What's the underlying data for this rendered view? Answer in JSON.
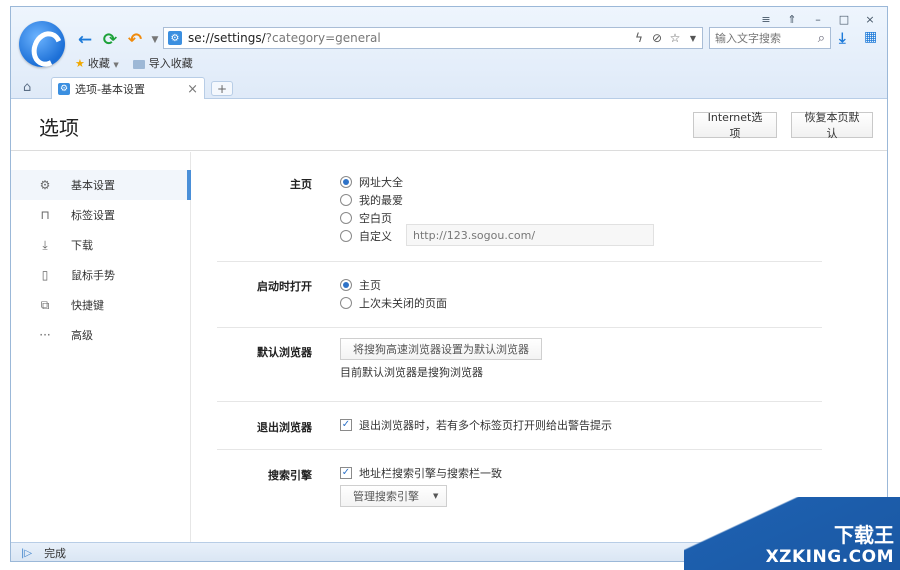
{
  "window": {
    "controls": [
      "≡",
      "⇑",
      "–",
      "□",
      "×"
    ]
  },
  "nav": {
    "back_icon": "arrow-left-icon",
    "refresh_icon": "refresh-icon",
    "undo_icon": "undo-icon"
  },
  "address": {
    "url_prefix": "se://settings/",
    "url_query": "?category=general"
  },
  "search": {
    "placeholder": "输入文字搜索"
  },
  "favbar": {
    "favorites": "收藏",
    "import": "导入收藏"
  },
  "tab": {
    "title": "选项-基本设置"
  },
  "header": {
    "title": "选项",
    "internet_options": "Internet选项",
    "reset_defaults": "恢复本页默认"
  },
  "sidebar": {
    "items": [
      {
        "label": "基本设置",
        "icon": "gear-icon"
      },
      {
        "label": "标签设置",
        "icon": "tab-icon"
      },
      {
        "label": "下载",
        "icon": "download-icon"
      },
      {
        "label": "鼠标手势",
        "icon": "mouse-icon"
      },
      {
        "label": "快捷键",
        "icon": "shortcut-icon"
      },
      {
        "label": "高级",
        "icon": "more-icon"
      }
    ]
  },
  "settings": {
    "homepage": {
      "label": "主页",
      "options": [
        "网址大全",
        "我的最爱",
        "空白页",
        "自定义"
      ],
      "custom_url": "http://123.sogou.com/"
    },
    "startup": {
      "label": "启动时打开",
      "options": [
        "主页",
        "上次未关闭的页面"
      ]
    },
    "default_browser": {
      "label": "默认浏览器",
      "button": "将搜狗高速浏览器设置为默认浏览器",
      "note": "目前默认浏览器是搜狗浏览器"
    },
    "exit": {
      "label": "退出浏览器",
      "option": "退出浏览器时，若有多个标签页打开则给出警告提示"
    },
    "search_engine": {
      "label": "搜索引擎",
      "option": "地址栏搜索引擎与搜索栏一致",
      "button": "管理搜索引擎"
    }
  },
  "status": {
    "text": "完成"
  },
  "watermark": {
    "line1": "下载王",
    "line2": "XZKING.COM"
  }
}
